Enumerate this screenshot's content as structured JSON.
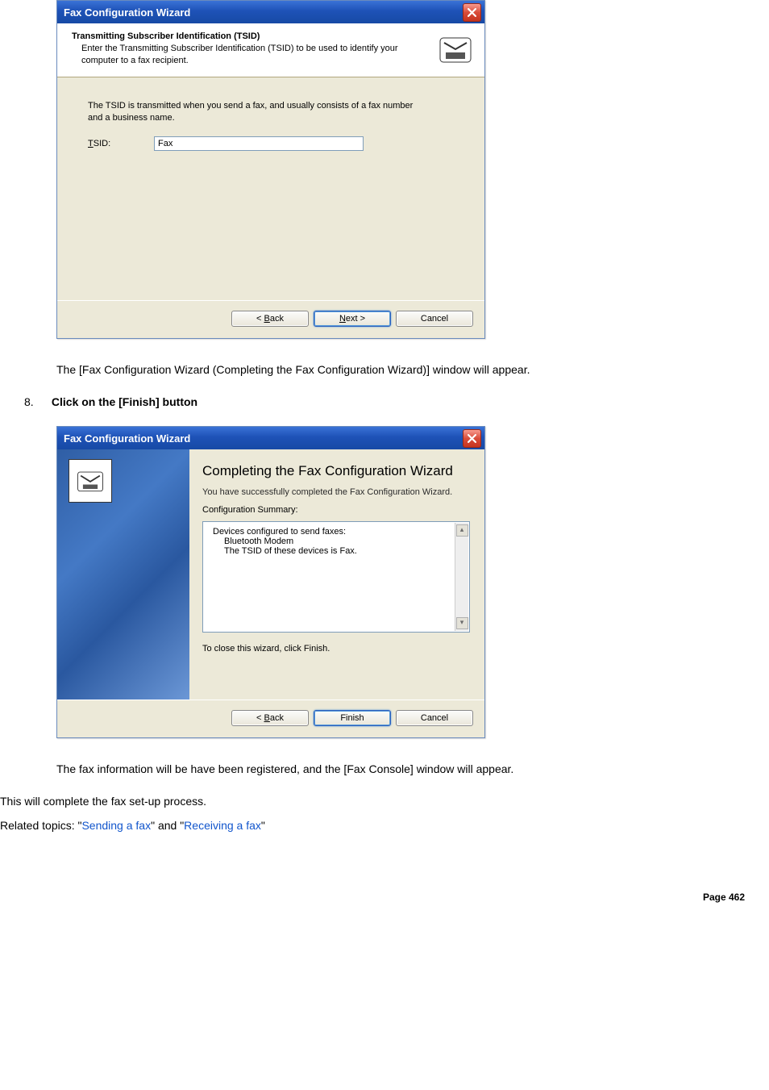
{
  "dialog1": {
    "title": "Fax Configuration Wizard",
    "header_title": "Transmitting Subscriber Identification (TSID)",
    "header_sub": "Enter the Transmitting Subscriber Identification (TSID) to be used to identify your computer to a fax recipient.",
    "info": "The TSID is transmitted when you send a fax, and usually consists of a fax number and a business name.",
    "tsid_label": "TSID:",
    "tsid_value": "Fax",
    "back": "< Back",
    "next": "Next >",
    "cancel": "Cancel"
  },
  "doc": {
    "after_d1": "The [Fax Configuration Wizard (Completing the Fax Configuration Wizard)] window will appear.",
    "step_num": "8.",
    "step_text": "Click on the [Finish] button"
  },
  "dialog2": {
    "title": "Fax Configuration Wizard",
    "heading": "Completing the Fax Configuration Wizard",
    "subhead": "You have successfully completed the Fax Configuration Wizard.",
    "summary_label": "Configuration Summary:",
    "summary_l1": "Devices configured to send faxes:",
    "summary_l2": "Bluetooth Modem",
    "summary_l3": "The TSID of these devices is Fax.",
    "close_hint": "To close this wizard, click Finish.",
    "back": "< Back",
    "finish": "Finish",
    "cancel": "Cancel"
  },
  "tail": {
    "p1": "The fax information will be have been registered, and the [Fax Console] window will appear.",
    "p2": "This will complete the fax set-up process.",
    "related_prefix": "Related topics: \"",
    "link1": "Sending a fax",
    "mid": "\" and \"",
    "link2": "Receiving a fax",
    "suffix": "\"",
    "page": "Page 462"
  }
}
